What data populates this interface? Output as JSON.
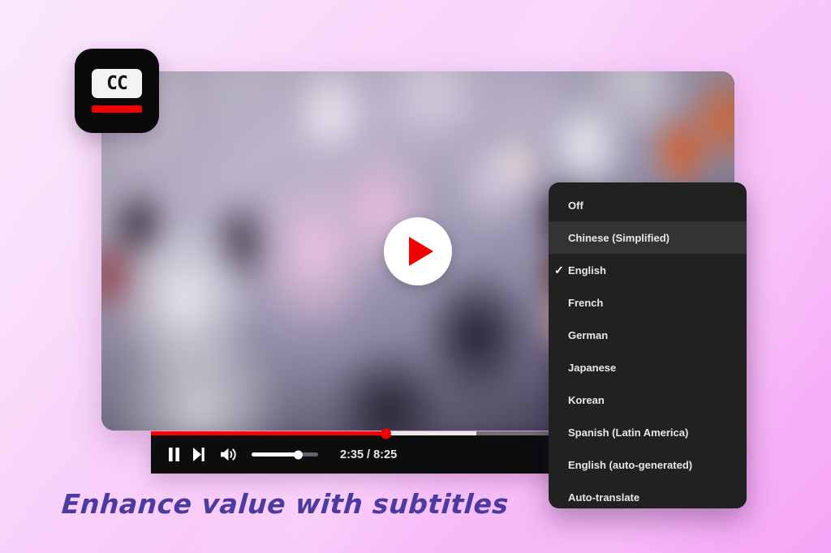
{
  "background": {
    "gradient_from": "#f9e2fb",
    "gradient_to": "#f6a6f7"
  },
  "badge": {
    "name": "cc-badge",
    "label": "CC",
    "bar_color": "#f50000",
    "background_color": "#0a0a0a"
  },
  "video": {
    "name": "video-player",
    "play_button_name": "play-button",
    "accent_color": "#f50000",
    "scene_description": "blurred crowd"
  },
  "controls": {
    "pause_label": "Pause",
    "next_label": "Next video",
    "volume_label": "Volume",
    "time_display": "2:35 / 8:25",
    "current_time": "2:35",
    "duration": "8:25",
    "progress_percent": 40,
    "buffered_percent": 55.5,
    "volume_percent": 70,
    "subtitles_label": "Subtitles/closed captions"
  },
  "captions_menu": {
    "selected": "English",
    "highlighted": "Chinese (Simplified)",
    "items": [
      {
        "label": "Off",
        "checked": false,
        "highlighted": false
      },
      {
        "label": "Chinese (Simplified)",
        "checked": false,
        "highlighted": true
      },
      {
        "label": "English",
        "checked": true,
        "highlighted": false
      },
      {
        "label": "French",
        "checked": false,
        "highlighted": false
      },
      {
        "label": "German",
        "checked": false,
        "highlighted": false
      },
      {
        "label": "Japanese",
        "checked": false,
        "highlighted": false
      },
      {
        "label": "Korean",
        "checked": false,
        "highlighted": false
      },
      {
        "label": "Spanish (Latin America)",
        "checked": false,
        "highlighted": false
      },
      {
        "label": "English (auto-generated)",
        "checked": false,
        "highlighted": false
      },
      {
        "label": "Auto-translate",
        "checked": false,
        "highlighted": false
      }
    ],
    "check_glyph": "✓"
  },
  "caption": {
    "text": "Enhance value with subtitles",
    "color": "#4b3ba0"
  }
}
